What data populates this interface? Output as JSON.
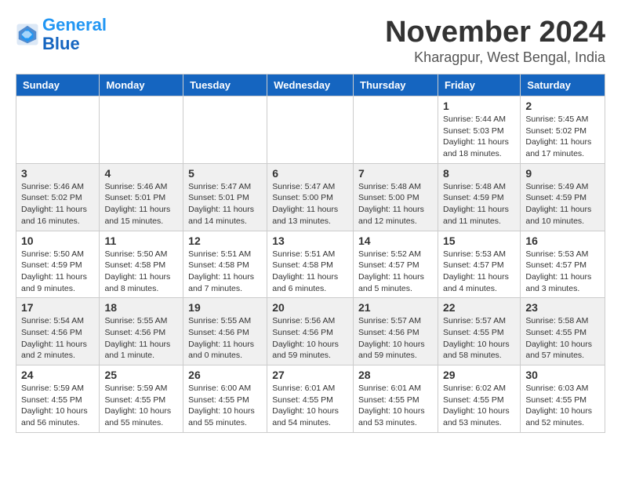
{
  "header": {
    "logo_line1": "General",
    "logo_line2": "Blue",
    "month": "November 2024",
    "location": "Kharagpur, West Bengal, India"
  },
  "days_of_week": [
    "Sunday",
    "Monday",
    "Tuesday",
    "Wednesday",
    "Thursday",
    "Friday",
    "Saturday"
  ],
  "weeks": [
    [
      {
        "day": "",
        "info": ""
      },
      {
        "day": "",
        "info": ""
      },
      {
        "day": "",
        "info": ""
      },
      {
        "day": "",
        "info": ""
      },
      {
        "day": "",
        "info": ""
      },
      {
        "day": "1",
        "info": "Sunrise: 5:44 AM\nSunset: 5:03 PM\nDaylight: 11 hours and 18 minutes."
      },
      {
        "day": "2",
        "info": "Sunrise: 5:45 AM\nSunset: 5:02 PM\nDaylight: 11 hours and 17 minutes."
      }
    ],
    [
      {
        "day": "3",
        "info": "Sunrise: 5:46 AM\nSunset: 5:02 PM\nDaylight: 11 hours and 16 minutes."
      },
      {
        "day": "4",
        "info": "Sunrise: 5:46 AM\nSunset: 5:01 PM\nDaylight: 11 hours and 15 minutes."
      },
      {
        "day": "5",
        "info": "Sunrise: 5:47 AM\nSunset: 5:01 PM\nDaylight: 11 hours and 14 minutes."
      },
      {
        "day": "6",
        "info": "Sunrise: 5:47 AM\nSunset: 5:00 PM\nDaylight: 11 hours and 13 minutes."
      },
      {
        "day": "7",
        "info": "Sunrise: 5:48 AM\nSunset: 5:00 PM\nDaylight: 11 hours and 12 minutes."
      },
      {
        "day": "8",
        "info": "Sunrise: 5:48 AM\nSunset: 4:59 PM\nDaylight: 11 hours and 11 minutes."
      },
      {
        "day": "9",
        "info": "Sunrise: 5:49 AM\nSunset: 4:59 PM\nDaylight: 11 hours and 10 minutes."
      }
    ],
    [
      {
        "day": "10",
        "info": "Sunrise: 5:50 AM\nSunset: 4:59 PM\nDaylight: 11 hours and 9 minutes."
      },
      {
        "day": "11",
        "info": "Sunrise: 5:50 AM\nSunset: 4:58 PM\nDaylight: 11 hours and 8 minutes."
      },
      {
        "day": "12",
        "info": "Sunrise: 5:51 AM\nSunset: 4:58 PM\nDaylight: 11 hours and 7 minutes."
      },
      {
        "day": "13",
        "info": "Sunrise: 5:51 AM\nSunset: 4:58 PM\nDaylight: 11 hours and 6 minutes."
      },
      {
        "day": "14",
        "info": "Sunrise: 5:52 AM\nSunset: 4:57 PM\nDaylight: 11 hours and 5 minutes."
      },
      {
        "day": "15",
        "info": "Sunrise: 5:53 AM\nSunset: 4:57 PM\nDaylight: 11 hours and 4 minutes."
      },
      {
        "day": "16",
        "info": "Sunrise: 5:53 AM\nSunset: 4:57 PM\nDaylight: 11 hours and 3 minutes."
      }
    ],
    [
      {
        "day": "17",
        "info": "Sunrise: 5:54 AM\nSunset: 4:56 PM\nDaylight: 11 hours and 2 minutes."
      },
      {
        "day": "18",
        "info": "Sunrise: 5:55 AM\nSunset: 4:56 PM\nDaylight: 11 hours and 1 minute."
      },
      {
        "day": "19",
        "info": "Sunrise: 5:55 AM\nSunset: 4:56 PM\nDaylight: 11 hours and 0 minutes."
      },
      {
        "day": "20",
        "info": "Sunrise: 5:56 AM\nSunset: 4:56 PM\nDaylight: 10 hours and 59 minutes."
      },
      {
        "day": "21",
        "info": "Sunrise: 5:57 AM\nSunset: 4:56 PM\nDaylight: 10 hours and 59 minutes."
      },
      {
        "day": "22",
        "info": "Sunrise: 5:57 AM\nSunset: 4:55 PM\nDaylight: 10 hours and 58 minutes."
      },
      {
        "day": "23",
        "info": "Sunrise: 5:58 AM\nSunset: 4:55 PM\nDaylight: 10 hours and 57 minutes."
      }
    ],
    [
      {
        "day": "24",
        "info": "Sunrise: 5:59 AM\nSunset: 4:55 PM\nDaylight: 10 hours and 56 minutes."
      },
      {
        "day": "25",
        "info": "Sunrise: 5:59 AM\nSunset: 4:55 PM\nDaylight: 10 hours and 55 minutes."
      },
      {
        "day": "26",
        "info": "Sunrise: 6:00 AM\nSunset: 4:55 PM\nDaylight: 10 hours and 55 minutes."
      },
      {
        "day": "27",
        "info": "Sunrise: 6:01 AM\nSunset: 4:55 PM\nDaylight: 10 hours and 54 minutes."
      },
      {
        "day": "28",
        "info": "Sunrise: 6:01 AM\nSunset: 4:55 PM\nDaylight: 10 hours and 53 minutes."
      },
      {
        "day": "29",
        "info": "Sunrise: 6:02 AM\nSunset: 4:55 PM\nDaylight: 10 hours and 53 minutes."
      },
      {
        "day": "30",
        "info": "Sunrise: 6:03 AM\nSunset: 4:55 PM\nDaylight: 10 hours and 52 minutes."
      }
    ]
  ]
}
